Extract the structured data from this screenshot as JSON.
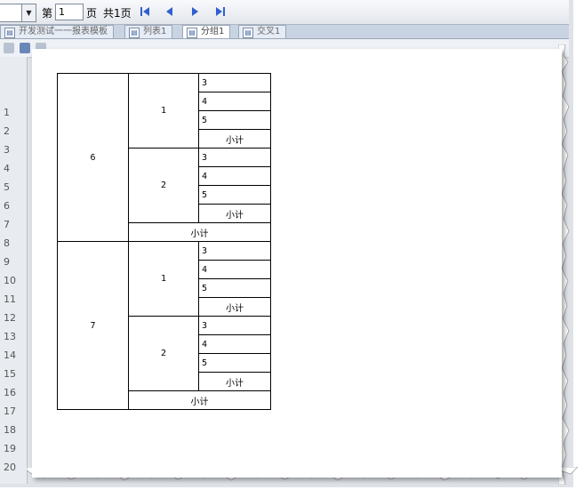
{
  "pager": {
    "page_prefix": "第",
    "page_value": "1",
    "page_suffix": "页",
    "total_text": "共1页",
    "first_icon": "first-page-icon",
    "prev_icon": "prev-page-icon",
    "next_icon": "next-page-icon",
    "last_icon": "last-page-icon"
  },
  "tabs": [
    {
      "label": "开发测试一一报表模板",
      "icon": "report-icon"
    },
    {
      "label": "列表1",
      "icon": "report-icon"
    },
    {
      "label": "分组1",
      "icon": "report-icon"
    },
    {
      "label": "交叉1",
      "icon": "report-icon"
    }
  ],
  "row_numbers": [
    "1",
    "2",
    "3",
    "4",
    "5",
    "6",
    "7",
    "8",
    "9",
    "10",
    "11",
    "12",
    "13",
    "14",
    "15",
    "16",
    "17",
    "18",
    "19",
    "20"
  ],
  "report": {
    "subtotal_label": "小计",
    "groups": [
      {
        "label": "6",
        "subgroups": [
          {
            "label": "1",
            "items": [
              "3",
              "4",
              "5"
            ]
          },
          {
            "label": "2",
            "items": [
              "3",
              "4",
              "5"
            ]
          }
        ]
      },
      {
        "label": "7",
        "subgroups": [
          {
            "label": "1",
            "items": [
              "3",
              "4",
              "5"
            ]
          },
          {
            "label": "2",
            "items": [
              "3",
              "4",
              "5"
            ]
          }
        ]
      }
    ]
  },
  "colors": {
    "nav_icon": "#2f5fd0",
    "toolbar_bg": "#e3e7ec"
  }
}
